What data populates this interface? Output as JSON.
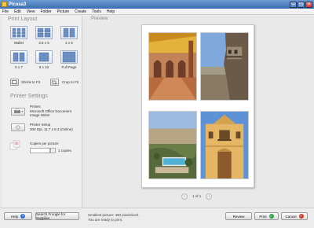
{
  "window": {
    "title": "Picasa3"
  },
  "menu": [
    "File",
    "Edit",
    "View",
    "Folder",
    "Picture",
    "Create",
    "Tools",
    "Help"
  ],
  "print_layout": {
    "title": "Print Layout",
    "options": [
      {
        "label": "Wallet",
        "selected": false
      },
      {
        "label": "3.5 x 5",
        "selected": false
      },
      {
        "label": "4 x 6",
        "selected": false
      },
      {
        "label": "5 x 7",
        "selected": false
      },
      {
        "label": "8 x 10",
        "selected": false
      },
      {
        "label": "Full Page",
        "selected": false
      }
    ],
    "shrink_to_fit": "Shrink to Fit",
    "crop_to_fit": "Crop to Fit"
  },
  "printer_settings": {
    "title": "Printer Settings",
    "printer_label": "Printer:",
    "printer_name": "Microsoft Office Document Image Writer",
    "setup_label": "Printer Setup",
    "setup_value": "300 Dpi, 11.7 x 8.3 (Online)",
    "copies_label": "Copies per picture",
    "copies_value": "1 copies"
  },
  "preview": {
    "label": "Preview",
    "page_indicator": "1 of 1"
  },
  "footer": {
    "help": "Help",
    "search_supplies": "Search Froogle for Supplies",
    "status_line1": "Smallest picture: 480 pixels/inch.",
    "status_line2": "You are ready to print.",
    "review": "Review",
    "print": "Print",
    "cancel": "Cancel"
  },
  "colors": {
    "accent": "#3a6db2",
    "ok": "#2da34a",
    "cancel": "#d23a2a"
  }
}
